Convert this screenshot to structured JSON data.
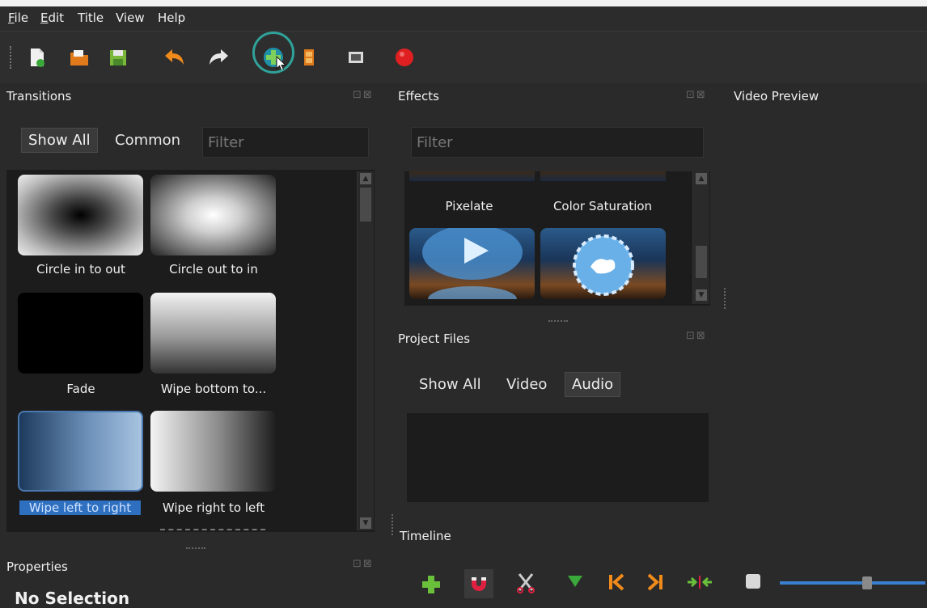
{
  "menu": {
    "file": {
      "u": "F",
      "rest": "ile"
    },
    "edit": {
      "u": "E",
      "rest": "dit"
    },
    "title": "Title",
    "view": "View",
    "help": "Help"
  },
  "transitions": {
    "title": "Transitions",
    "tabs": [
      "Show All",
      "Common"
    ],
    "filter_placeholder": "Filter",
    "items": [
      {
        "label": "Circle in to out"
      },
      {
        "label": "Circle out to in"
      },
      {
        "label": "Fade"
      },
      {
        "label": "Wipe bottom to..."
      },
      {
        "label": "Wipe left to right"
      },
      {
        "label": "Wipe right to left"
      }
    ]
  },
  "effects": {
    "title": "Effects",
    "filter_placeholder": "Filter",
    "items": [
      {
        "label": "Pixelate"
      },
      {
        "label": "Color Saturation"
      }
    ]
  },
  "video_preview": {
    "title": "Video Preview"
  },
  "project_files": {
    "title": "Project Files",
    "tabs": [
      "Show All",
      "Video",
      "Audio"
    ]
  },
  "timeline": {
    "title": "Timeline"
  },
  "properties": {
    "title": "Properties",
    "selection": "No Selection"
  },
  "colors": {
    "accent": "#2fa39a",
    "selection": "#2f6fbf",
    "record": "#e02020"
  }
}
